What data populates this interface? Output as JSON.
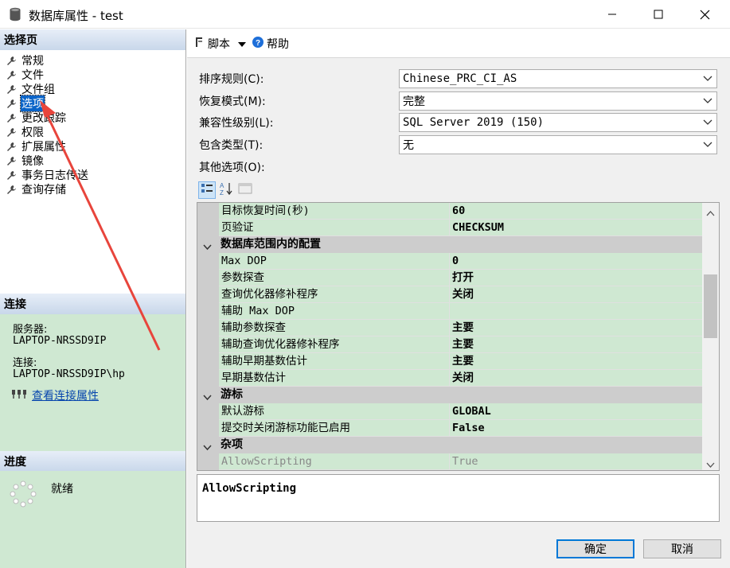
{
  "window": {
    "title": "数据库属性 - test"
  },
  "left": {
    "select_page_header": "选择页",
    "pages": [
      "常规",
      "文件",
      "文件组",
      "选项",
      "更改跟踪",
      "权限",
      "扩展属性",
      "镜像",
      "事务日志传送",
      "查询存储"
    ],
    "selected_page": "选项",
    "connection_header": "连接",
    "server_label": "服务器:",
    "server_value": "LAPTOP-NRSSD9IP",
    "connection_label": "连接:",
    "connection_value": "LAPTOP-NRSSD9IP\\hp",
    "view_connection_link": "查看连接属性",
    "progress_header": "进度",
    "progress_status": "就绪"
  },
  "toolbar": {
    "script_label": "脚本",
    "help_label": "帮助"
  },
  "form": {
    "collation_label": "排序规则(C):",
    "collation_value": "Chinese_PRC_CI_AS",
    "recovery_label": "恢复模式(M):",
    "recovery_value": "完整",
    "compat_label": "兼容性级别(L):",
    "compat_value": "SQL Server 2019 (150)",
    "containment_label": "包含类型(T):",
    "containment_value": "无",
    "other_options_label": "其他选项(O):"
  },
  "grid": {
    "rows": [
      {
        "type": "prop",
        "name": "目标恢复时间(秒)",
        "value": "60"
      },
      {
        "type": "prop",
        "name": "页验证",
        "value": "CHECKSUM"
      },
      {
        "type": "cat",
        "name": "数据库范围内的配置"
      },
      {
        "type": "prop",
        "name": "Max DOP",
        "value": "0"
      },
      {
        "type": "prop",
        "name": "参数探查",
        "value": "打开"
      },
      {
        "type": "prop",
        "name": "查询优化器修补程序",
        "value": "关闭"
      },
      {
        "type": "prop",
        "name": "辅助 Max DOP",
        "value": ""
      },
      {
        "type": "prop",
        "name": "辅助参数探查",
        "value": "主要"
      },
      {
        "type": "prop",
        "name": "辅助查询优化器修补程序",
        "value": "主要"
      },
      {
        "type": "prop",
        "name": "辅助早期基数估计",
        "value": "主要"
      },
      {
        "type": "prop",
        "name": "早期基数估计",
        "value": "关闭"
      },
      {
        "type": "cat",
        "name": "游标"
      },
      {
        "type": "prop",
        "name": "默认游标",
        "value": "GLOBAL"
      },
      {
        "type": "prop",
        "name": "提交时关闭游标功能已启用",
        "value": "False"
      },
      {
        "type": "cat",
        "name": "杂项"
      },
      {
        "type": "dim",
        "name": "AllowScripting",
        "value": "True"
      }
    ]
  },
  "description": {
    "text": "AllowScripting"
  },
  "buttons": {
    "ok_label": "确定",
    "cancel_label": "取消"
  },
  "colors": {
    "section_bg": "#cfe8d2",
    "accent": "#0078d7",
    "annotation_arrow": "#e8453c"
  }
}
